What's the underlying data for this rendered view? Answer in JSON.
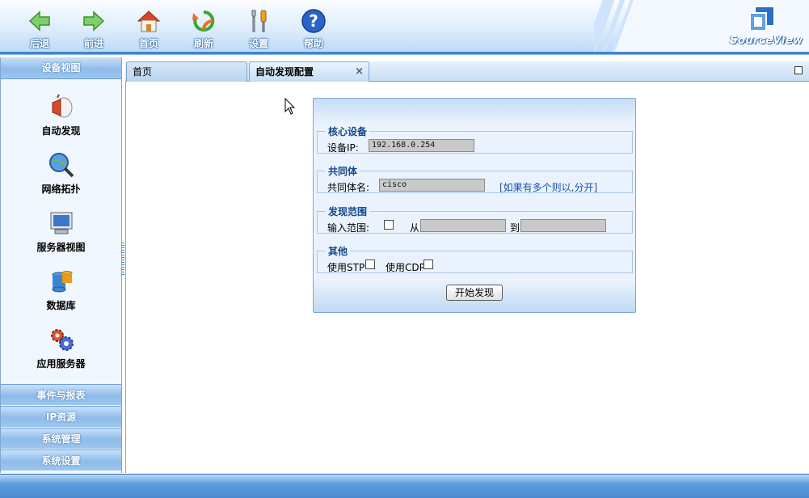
{
  "toolbar": {
    "back": "后退",
    "forward": "前进",
    "home": "首页",
    "refresh": "刷新",
    "settings": "设置",
    "help": "帮助"
  },
  "brand": {
    "name": "SourceView"
  },
  "sidebar": {
    "header": "设备视图",
    "items": [
      {
        "label": "自动发现",
        "icon": "auto-discovery-icon"
      },
      {
        "label": "网络拓扑",
        "icon": "network-topology-icon"
      },
      {
        "label": "服务器视图",
        "icon": "server-view-icon"
      },
      {
        "label": "数据库",
        "icon": "database-icon"
      },
      {
        "label": "应用服务器",
        "icon": "app-server-icon"
      }
    ],
    "sections": [
      "事件与报表",
      "IP资源",
      "系统管理",
      "系统设置"
    ]
  },
  "tabs": [
    {
      "label": "首页",
      "active": false
    },
    {
      "label": "自动发现配置",
      "active": true,
      "close": "×"
    }
  ],
  "form": {
    "core": {
      "legend": "核心设备",
      "ip_label": "设备IP:",
      "ip_value": "192.168.0.254"
    },
    "community": {
      "legend": "共同体",
      "name_label": "共同体名:",
      "name_value": "cisco",
      "hint": "[如果有多个则以,分开]"
    },
    "range": {
      "legend": "发现范围",
      "input_label": "输入范围:",
      "from_label": "从",
      "to_label": "到",
      "from_value": "",
      "to_value": ""
    },
    "other": {
      "legend": "其他",
      "stp_label": "使用STP",
      "cdp_label": "使用CDP"
    },
    "submit": "开始发现"
  },
  "colors": {
    "accent": "#3d87d3",
    "panel_bg": "#eaf3fd",
    "legend": "#13488a",
    "hint": "#1a4fa6"
  }
}
